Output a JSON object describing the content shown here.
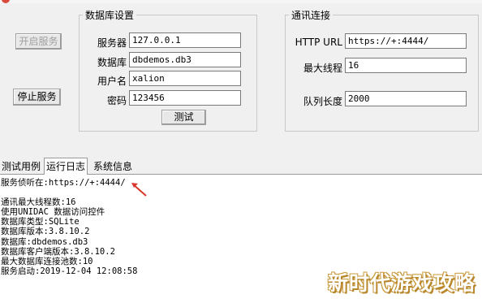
{
  "window": {
    "title": ""
  },
  "left_buttons": {
    "start": "开启服务",
    "stop": "停止服务"
  },
  "db_group": {
    "title": "数据库设置",
    "server_label": "服务器",
    "server_value": "127.0.0.1",
    "db_label": "数据库",
    "db_value": "dbdemos.db3",
    "user_label": "用户名",
    "user_value": "xalion",
    "password_label": "密码",
    "password_value": "123456",
    "test_button": "测试"
  },
  "comm_group": {
    "title": "通讯连接",
    "url_label": "HTTP URL",
    "url_value": "https://+:4444/",
    "threads_label": "最大线程",
    "threads_value": "16",
    "queue_label": "队列长度",
    "queue_value": "2000"
  },
  "tabs": [
    "测试用例",
    "运行日志",
    "系统信息"
  ],
  "active_tab": "运行日志",
  "log_lines": [
    "服务侦听在:https://+:4444/",
    "",
    "通讯最大线程数:16",
    "使用UNIDAC 数据访问控件",
    "数据库类型:SQLite",
    "数据库版本:3.8.10.2",
    "数据库:dbdemos.db3",
    "数据库客户端版本:3.8.10.2",
    "最大数据库连接池数:10",
    "服务启动:2019-12-04 12:08:58"
  ],
  "watermark": "新时代游戏攻略",
  "colors": {
    "dialog_bg": "#f0f0f0",
    "annotation_arrow": "#d9362b",
    "watermark_outline": "#b8862b"
  },
  "icons": {
    "app": "app-icon",
    "annotation": "arrow-annotation-icon"
  }
}
